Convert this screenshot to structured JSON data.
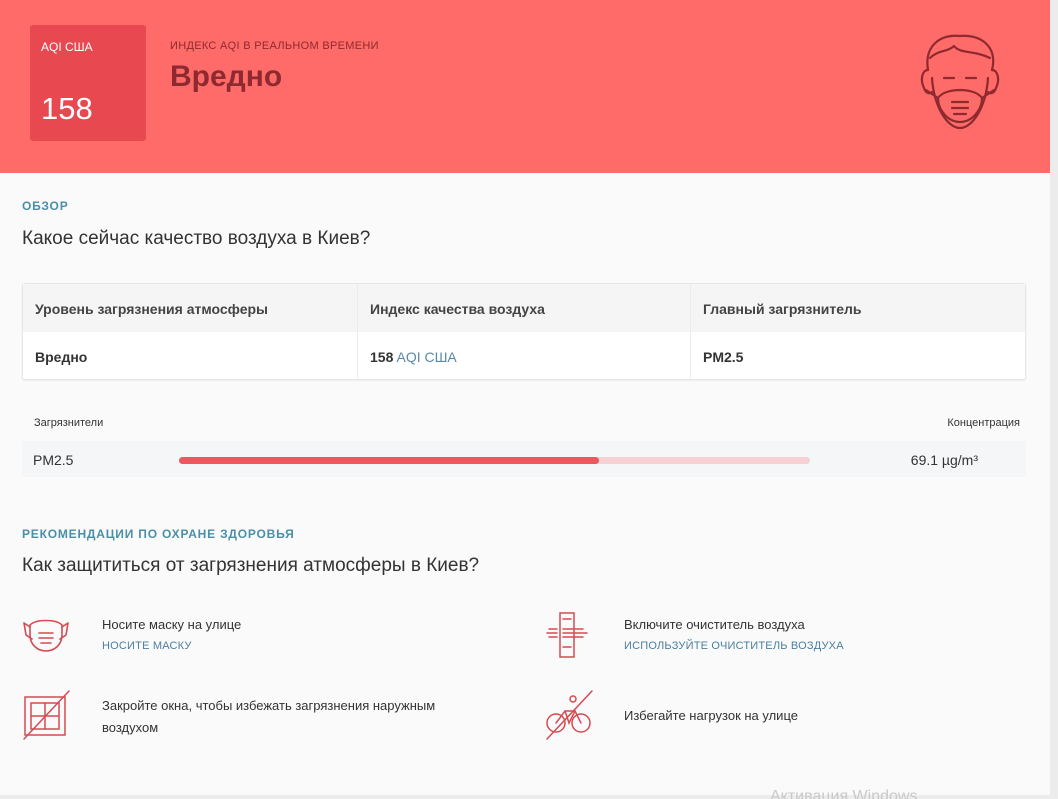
{
  "header": {
    "aqi_label": "AQI США",
    "aqi_value": "158",
    "subtitle": "ИНДЕКС AQI В РЕАЛЬНОМ ВРЕМЕНИ",
    "status": "Вредно",
    "accent_color": "#ff6b68",
    "box_color": "#e8484f",
    "icon": "face-mask-icon"
  },
  "overview": {
    "tag": "ОБЗОР",
    "title": "Какое сейчас качество воздуха в Киев?",
    "table": {
      "headers": [
        "Уровень загрязнения атмосферы",
        "Индекс качества воздуха",
        "Главный загрязнитель"
      ],
      "level": "Вредно",
      "aqi_number": "158",
      "aqi_unit": "AQI США",
      "main_pollutant": "PM2.5"
    }
  },
  "pollutants": {
    "col_name": "Загрязнители",
    "col_value": "Концентрация",
    "items": [
      {
        "name": "PM2.5",
        "value": "69.1 µg/m³",
        "level_fraction": 0.665
      }
    ]
  },
  "health": {
    "tag": "РЕКОМЕНДАЦИИ ПО ОХРАНЕ ЗДОРОВЬЯ",
    "title": "Как защититься от загрязнения атмосферы в Киев?",
    "recommendations": [
      {
        "icon": "mask-icon",
        "text": "Носите маску на улице",
        "link": "НОСИТЕ МАСКУ"
      },
      {
        "icon": "air-purifier-icon",
        "text": "Включите очиститель воздуха",
        "link": "ИСПОЛЬЗУЙТЕ ОЧИСТИТЕЛЬ ВОЗДУХА"
      },
      {
        "icon": "closed-window-icon",
        "text": "Закройте окна, чтобы избежать загрязнения наружным воздухом"
      },
      {
        "icon": "no-cycling-icon",
        "text": "Избегайте нагрузок на улице"
      }
    ]
  },
  "watermark": "Активация Windows"
}
